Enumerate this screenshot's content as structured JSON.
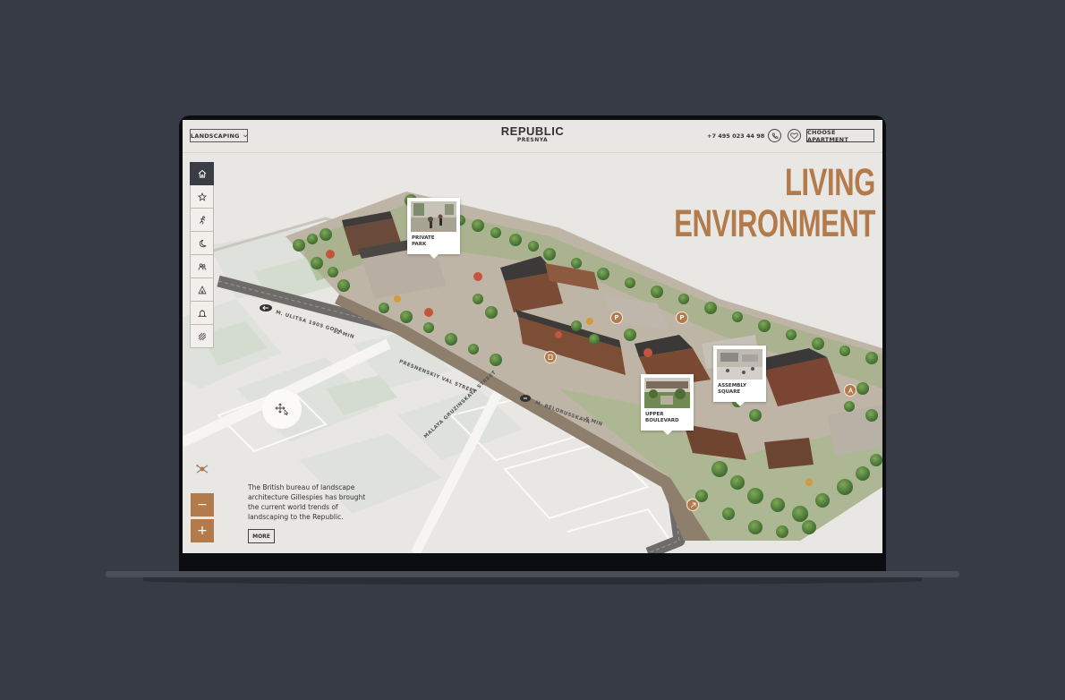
{
  "colors": {
    "accent": "#b37b4c",
    "background": "#373b45",
    "sidebar_active": "#3a3d46"
  },
  "header": {
    "dropdown_label": "LANDSCAPING",
    "logo_line1": "REPUBLIC",
    "logo_line2": "PRESNYA",
    "phone": "+7 495 023 44 98",
    "choose_button": "CHOOSE APARTMENT"
  },
  "headline": "LIVING ENVIRONMENT",
  "sidebar": {
    "items": [
      {
        "icon": "home-icon",
        "active": true
      },
      {
        "icon": "star-icon"
      },
      {
        "icon": "running-icon"
      },
      {
        "icon": "moon-icon"
      },
      {
        "icon": "people-icon"
      },
      {
        "icon": "tent-icon"
      },
      {
        "icon": "bell-icon"
      },
      {
        "icon": "waves-icon"
      }
    ]
  },
  "callouts": [
    {
      "label_line1": "PRIVATE",
      "label_line2": "PARK"
    },
    {
      "label_line1": "ASSEMBLY",
      "label_line2": "SQUARE"
    },
    {
      "label_line1": "UPPER",
      "label_line2": "BOULEVARD"
    }
  ],
  "streets": {
    "ulitsa": "M. ULITSA 1905 GODA",
    "ulitsa_time": "12 MIN",
    "presnensky": "PRESNENSKIY VAL STREET",
    "gruzinskaya": "MALAYA GRUZINSKAYA STREET",
    "belorusskaya": "M. BELORUSSKAYA",
    "belorusskaya_time": "5 MIN"
  },
  "description": "The British bureau of landscape architecture Gillespies has brought the current world trends of landscaping to the Republic.",
  "more_button": "MORE",
  "zoom": {
    "minus": "−",
    "plus": "+"
  }
}
